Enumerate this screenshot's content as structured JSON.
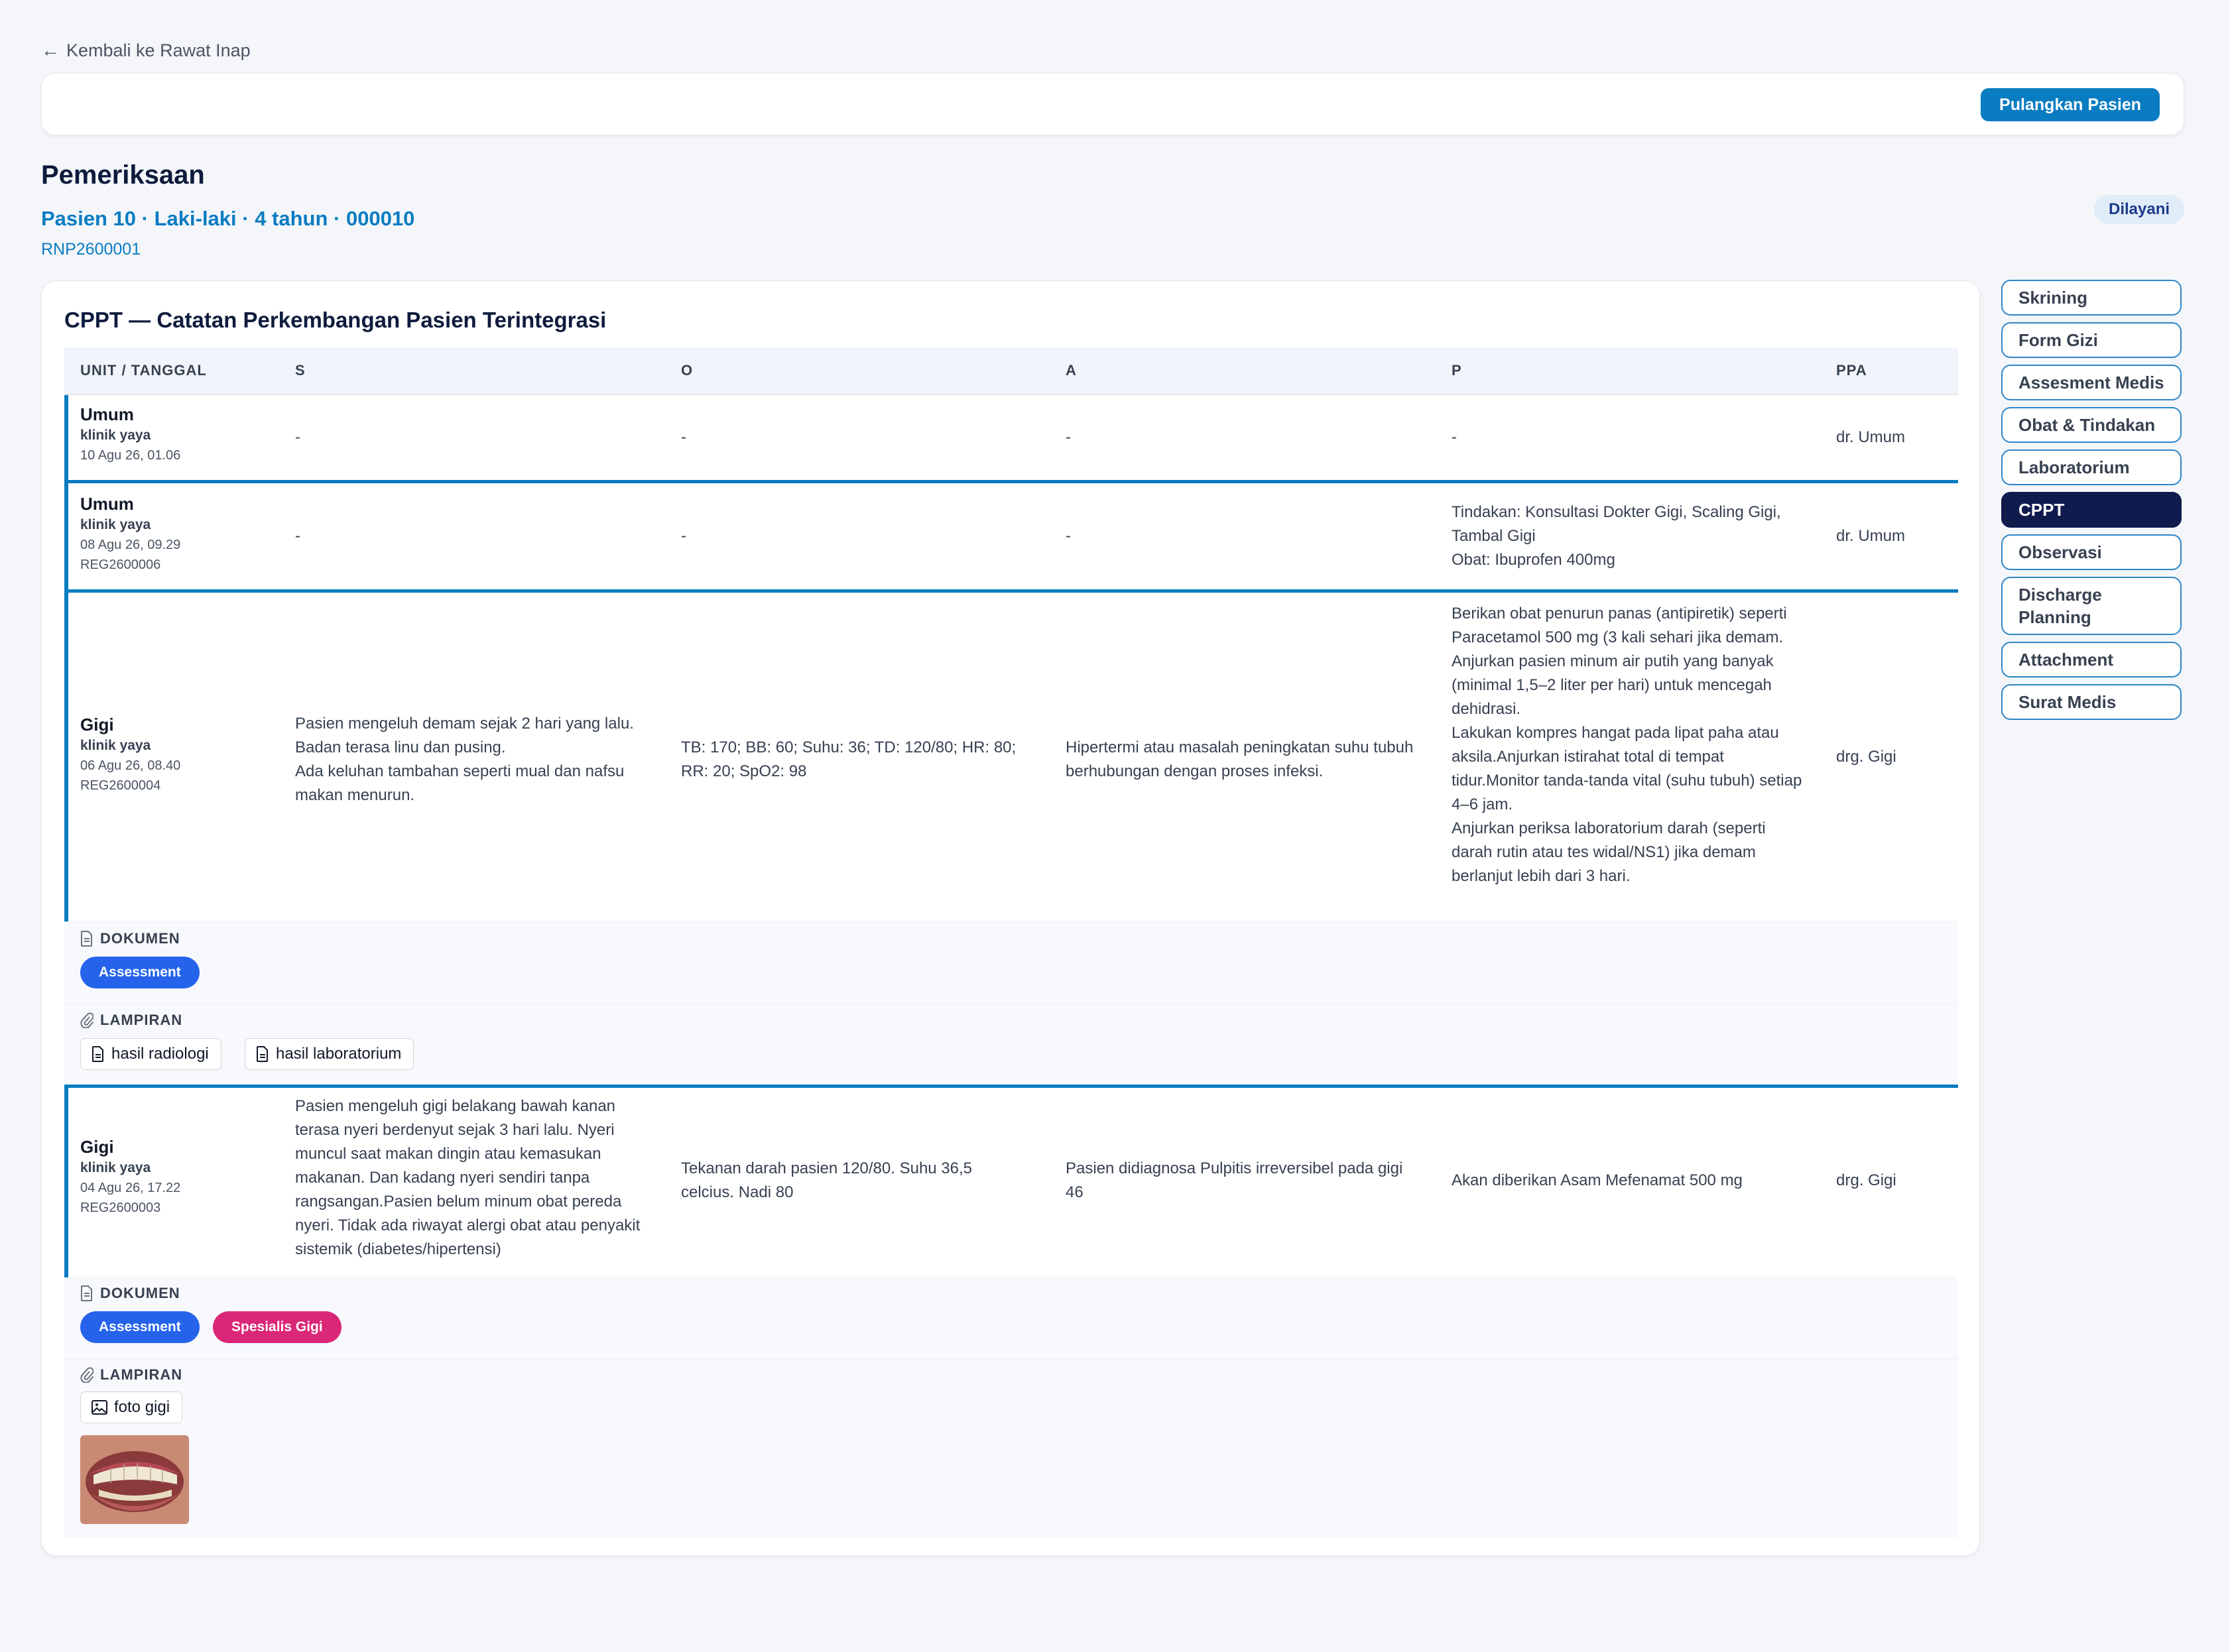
{
  "back_link": "Kembali ke Rawat Inap",
  "actions": {
    "discharge_label": "Pulangkan Pasien"
  },
  "page": {
    "title": "Pemeriksaan",
    "patient_line": "Pasien 10 · Laki-laki · 4 tahun · 000010",
    "patient_id": "RNP2600001",
    "status": "Dilayani"
  },
  "cppt": {
    "title": "CPPT — Catatan Perkembangan Pasien Terintegrasi",
    "columns": [
      "UNIT / TANGGAL",
      "S",
      "O",
      "A",
      "P",
      "PPA"
    ],
    "rows": [
      {
        "unit": "Umum",
        "clinic": "klinik yaya",
        "date": "10 Agu 26, 01.06",
        "reg": "",
        "s": "-",
        "o": "-",
        "a": "-",
        "p": "-",
        "ppa": "dr. Umum"
      },
      {
        "unit": "Umum",
        "clinic": "klinik yaya",
        "date": "08 Agu 26, 09.29",
        "reg": "REG2600006",
        "s": "-",
        "o": "-",
        "a": "-",
        "p": "Tindakan: Konsultasi Dokter Gigi, Scaling Gigi, Tambal Gigi\nObat: Ibuprofen 400mg",
        "ppa": "dr. Umum"
      },
      {
        "unit": "Gigi",
        "clinic": "klinik yaya",
        "date": "06 Agu 26, 08.40",
        "reg": "REG2600004",
        "s": "Pasien mengeluh demam sejak 2 hari yang lalu. Badan terasa linu dan pusing.\nAda keluhan tambahan seperti mual dan nafsu makan menurun.",
        "o": "TB: 170; BB: 60; Suhu: 36; TD: 120/80; HR: 80; RR: 20; SpO2: 98",
        "a": "Hipertermi atau masalah peningkatan suhu tubuh berhubungan dengan proses infeksi.",
        "p": "Berikan obat penurun panas (antipiretik) seperti Paracetamol 500 mg (3 kali sehari jika demam.\nAnjurkan pasien minum air putih yang banyak (minimal 1,5–2 liter per hari) untuk mencegah dehidrasi.\nLakukan kompres hangat pada lipat paha atau aksila.Anjurkan istirahat total di tempat tidur.Monitor tanda-tanda vital (suhu tubuh) setiap 4–6 jam.\nAnjurkan periksa laboratorium darah (seperti darah rutin atau tes widal/NS1) jika demam berlanjut lebih dari 3 hari.",
        "ppa": "drg. Gigi",
        "documents": [
          "Assessment"
        ],
        "attachments": [
          "hasil radiologi",
          "hasil laboratorium"
        ]
      },
      {
        "unit": "Gigi",
        "clinic": "klinik yaya",
        "date": "04 Agu 26, 17.22",
        "reg": "REG2600003",
        "s": "Pasien mengeluh gigi belakang bawah kanan terasa nyeri berdenyut sejak 3 hari lalu. Nyeri muncul saat makan dingin atau kemasukan makanan. Dan kadang nyeri sendiri tanpa rangsangan.Pasien belum minum obat pereda nyeri. Tidak ada riwayat alergi obat atau penyakit sistemik (diabetes/hipertensi)",
        "o": "Tekanan darah pasien 120/80. Suhu 36,5 celcius. Nadi 80",
        "a": "Pasien didiagnosa Pulpitis irreversibel pada gigi 46",
        "p": "Akan diberikan Asam Mefenamat 500 mg",
        "ppa": "drg. Gigi",
        "documents": [
          "Assessment",
          "Spesialis Gigi"
        ],
        "attachments": [
          "foto gigi"
        ]
      }
    ],
    "dokumen_label": "DOKUMEN",
    "lampiran_label": "LAMPIRAN"
  },
  "sidenav": {
    "items": [
      "Skrining",
      "Form Gizi",
      "Assesment Medis",
      "Obat & Tindakan",
      "Laboratorium",
      "CPPT",
      "Observasi",
      "Discharge Planning",
      "Attachment",
      "Surat Medis"
    ],
    "active": "CPPT"
  },
  "colors": {
    "accent": "#0a7cc2",
    "active_nav": "#0f1b4d",
    "pill_blue": "#2563eb",
    "pill_pink": "#db2777"
  }
}
